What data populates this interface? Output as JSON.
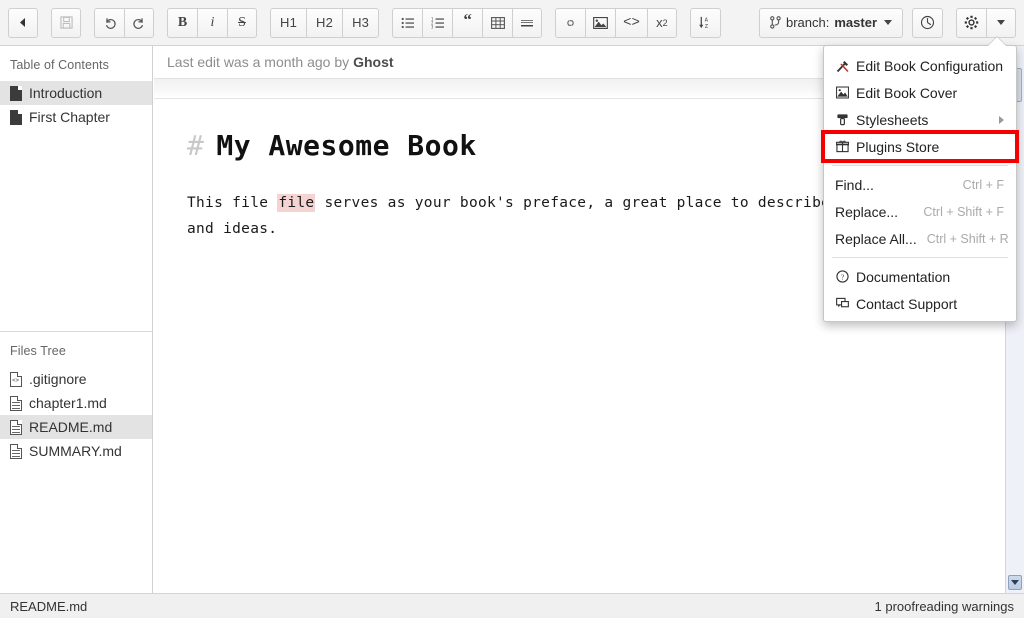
{
  "toolbar": {
    "groups": [
      {
        "name": "nav",
        "buttons": [
          {
            "name": "back-button",
            "icon": "triangle-left-icon",
            "label": "◀"
          }
        ]
      },
      {
        "name": "save",
        "buttons": [
          {
            "name": "save-button",
            "icon": "floppy-disk-icon",
            "label": ""
          }
        ]
      },
      {
        "name": "history",
        "buttons": [
          {
            "name": "undo-button",
            "icon": "undo-arrow-icon",
            "label": "↺"
          },
          {
            "name": "redo-button",
            "icon": "redo-arrow-icon",
            "label": "↻"
          }
        ]
      },
      {
        "name": "inline-format",
        "buttons": [
          {
            "name": "bold-button",
            "icon": "bold-icon",
            "label": "B"
          },
          {
            "name": "italic-button",
            "icon": "italic-icon",
            "label": "i"
          },
          {
            "name": "strikethrough-button",
            "icon": "strikethrough-icon",
            "label": "S"
          }
        ]
      },
      {
        "name": "headings",
        "buttons": [
          {
            "name": "heading-1-button",
            "icon": "h1-icon",
            "label": "H1"
          },
          {
            "name": "heading-2-button",
            "icon": "h2-icon",
            "label": "H2"
          },
          {
            "name": "heading-3-button",
            "icon": "h3-icon",
            "label": "H3"
          }
        ]
      },
      {
        "name": "blocks",
        "buttons": [
          {
            "name": "bullet-list-button",
            "icon": "bullet-list-icon",
            "label": ""
          },
          {
            "name": "numbered-list-button",
            "icon": "numbered-list-icon",
            "label": ""
          },
          {
            "name": "blockquote-button",
            "icon": "quote-icon",
            "label": "“"
          },
          {
            "name": "table-button",
            "icon": "table-icon",
            "label": ""
          },
          {
            "name": "horizontal-rule-button",
            "icon": "horizontal-rule-icon",
            "label": ""
          }
        ]
      },
      {
        "name": "insert",
        "buttons": [
          {
            "name": "link-button",
            "icon": "link-icon",
            "label": ""
          },
          {
            "name": "image-button",
            "icon": "image-icon",
            "label": ""
          },
          {
            "name": "code-button",
            "icon": "code-icon",
            "label": "<>"
          },
          {
            "name": "subscript-button",
            "icon": "subscript-icon",
            "label": "x"
          }
        ]
      },
      {
        "name": "sort",
        "buttons": [
          {
            "name": "sort-button",
            "icon": "sort-az-icon",
            "label": ""
          }
        ]
      }
    ],
    "branch_prefix": "branch:",
    "branch_name": "master",
    "history_button_title": "history",
    "settings_button_title": "settings",
    "settings_dropdown_title": "settings dropdown"
  },
  "sidebar": {
    "toc_title": "Table of Contents",
    "toc_items": [
      {
        "label": "Introduction",
        "selected": true
      },
      {
        "label": "First Chapter",
        "selected": false
      }
    ],
    "files_title": "Files Tree",
    "files_items": [
      {
        "label": ".gitignore",
        "selected": false,
        "kind": "code"
      },
      {
        "label": "chapter1.md",
        "selected": false,
        "kind": "doc"
      },
      {
        "label": "README.md",
        "selected": true,
        "kind": "doc"
      },
      {
        "label": "SUMMARY.md",
        "selected": false,
        "kind": "doc"
      }
    ]
  },
  "editor": {
    "last_edit_prefix": "Last edit was a month ago by",
    "last_edit_author": "Ghost",
    "heading_hash": "#",
    "heading_text": "My Awesome Book",
    "paragraph_part1": "This file ",
    "paragraph_warning_word": "file",
    "paragraph_part2": " serves as your book's preface, a great place to describe your",
    "paragraph_line2": "and ideas."
  },
  "menu": {
    "items": [
      {
        "label": "Edit Book Configuration",
        "icon": "tools-icon",
        "shortcut": "",
        "submenu": false,
        "highlight": false
      },
      {
        "label": "Edit Book Cover",
        "icon": "picture-icon",
        "shortcut": "",
        "submenu": false,
        "highlight": false
      },
      {
        "label": "Stylesheets",
        "icon": "paint-roller-icon",
        "shortcut": "",
        "submenu": true,
        "highlight": false
      },
      {
        "label": "Plugins Store",
        "icon": "plugin-box-icon",
        "shortcut": "",
        "submenu": false,
        "highlight": true
      },
      {
        "separator": true
      },
      {
        "label": "Find...",
        "icon": "",
        "shortcut": "Ctrl + F",
        "submenu": false,
        "highlight": false
      },
      {
        "label": "Replace...",
        "icon": "",
        "shortcut": "Ctrl + Shift + F",
        "submenu": false,
        "highlight": false
      },
      {
        "label": "Replace All...",
        "icon": "",
        "shortcut": "Ctrl + Shift + R",
        "submenu": false,
        "highlight": false
      },
      {
        "separator": true
      },
      {
        "label": "Documentation",
        "icon": "question-circle-icon",
        "shortcut": "",
        "submenu": false,
        "highlight": false
      },
      {
        "label": "Contact Support",
        "icon": "chat-bubble-icon",
        "shortcut": "",
        "submenu": false,
        "highlight": false
      }
    ],
    "highlight_color": "#f40000"
  },
  "statusbar": {
    "file_name": "README.md",
    "warnings": "1 proofreading warnings"
  }
}
